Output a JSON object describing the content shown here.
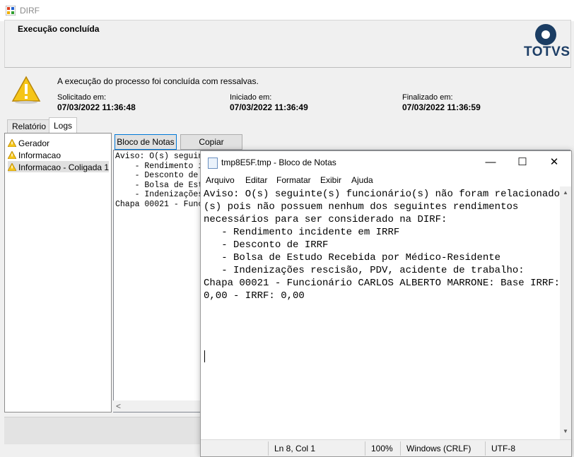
{
  "window": {
    "title": "DIRF"
  },
  "header": {
    "title": "Execução concluída",
    "logo_text": "TOTVS"
  },
  "info": {
    "message": "A execução do processo foi concluída com ressalvas.",
    "solicitado_label": "Solicitado em:",
    "solicitado_value": "07/03/2022 11:36:48",
    "iniciado_label": "Iniciado em:",
    "iniciado_value": "07/03/2022 11:36:49",
    "finalizado_label": "Finalizado em:",
    "finalizado_value": "07/03/2022 11:36:59"
  },
  "tabs": [
    {
      "label": "Relatório"
    },
    {
      "label": "Logs"
    }
  ],
  "tree": {
    "items": [
      {
        "label": "Gerador"
      },
      {
        "label": "Informacao"
      },
      {
        "label": "Informacao - Coligada 1"
      }
    ]
  },
  "log": {
    "bloco_button": "Bloco de Notas",
    "copiar_button": "Copiar",
    "text": "Aviso: O(s) seguin\n    - Rendimento in\n    - Desconto de I\n    - Bolsa de Estu\n    - Indenizações\nChapa 00021 - Func"
  },
  "notepad": {
    "title": "tmp8E5F.tmp - Bloco de Notas",
    "menu": [
      "Arquivo",
      "Editar",
      "Formatar",
      "Exibir",
      "Ajuda"
    ],
    "text": "Aviso: O(s) seguinte(s) funcionário(s) não foram relacionado\n(s) pois não possuem nenhum dos seguintes rendimentos\nnecessários para ser considerado na DIRF:\n   - Rendimento incidente em IRRF\n   - Desconto de IRRF\n   - Bolsa de Estudo Recebida por Médico-Residente\n   - Indenizações rescisão, PDV, acidente de trabalho:\nChapa 00021 - Funcionário CARLOS ALBERTO MARRONE: Base IRRF:\n0,00 - IRRF: 0,00",
    "status": {
      "position": "Ln 8, Col 1",
      "zoom": "100%",
      "line_ending": "Windows (CRLF)",
      "encoding": "UTF-8"
    }
  },
  "colors": {
    "logo": "#1d3e66",
    "warning": "#f5c518"
  }
}
